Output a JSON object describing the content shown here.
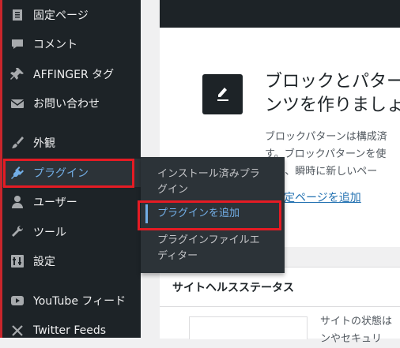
{
  "sidebar": {
    "items": [
      {
        "label": "固定ページ",
        "icon": "page-icon"
      },
      {
        "label": "コメント",
        "icon": "comment-icon"
      },
      {
        "label": "AFFINGER タグ",
        "icon": "pin-icon"
      },
      {
        "label": "お問い合わせ",
        "icon": "mail-icon"
      },
      {
        "label": "外観",
        "icon": "brush-icon"
      },
      {
        "label": "プラグイン",
        "icon": "plugin-icon"
      },
      {
        "label": "ユーザー",
        "icon": "user-icon"
      },
      {
        "label": "ツール",
        "icon": "wrench-icon"
      },
      {
        "label": "設定",
        "icon": "settings-icon"
      },
      {
        "label": "YouTube フィード",
        "icon": "youtube-icon"
      },
      {
        "label": "Twitter Feeds",
        "icon": "twitter-icon"
      }
    ]
  },
  "plugin_submenu": {
    "items": [
      {
        "label": "インストール済みプラ\nグイン"
      },
      {
        "label": "プラグインを追加"
      },
      {
        "label": "プラグインファイルエ\nディター"
      }
    ]
  },
  "welcome_card": {
    "heading": "ブロックとパター\nンツを作りましょ",
    "description": "ブロックパターンは構成済\nす。ブロックパターンを使\nより、瞬時に新しいペー",
    "link": "固定ページを追加"
  },
  "site_health": {
    "title": "サイトヘルスステータス",
    "text": "サイトの状態は\nンやセキュリ"
  },
  "colors": {
    "sidebar_bg": "#1d2327",
    "submenu_bg": "#2c3338",
    "accent": "#72aee6",
    "highlight": "#e51b24",
    "link": "#2271b1"
  }
}
